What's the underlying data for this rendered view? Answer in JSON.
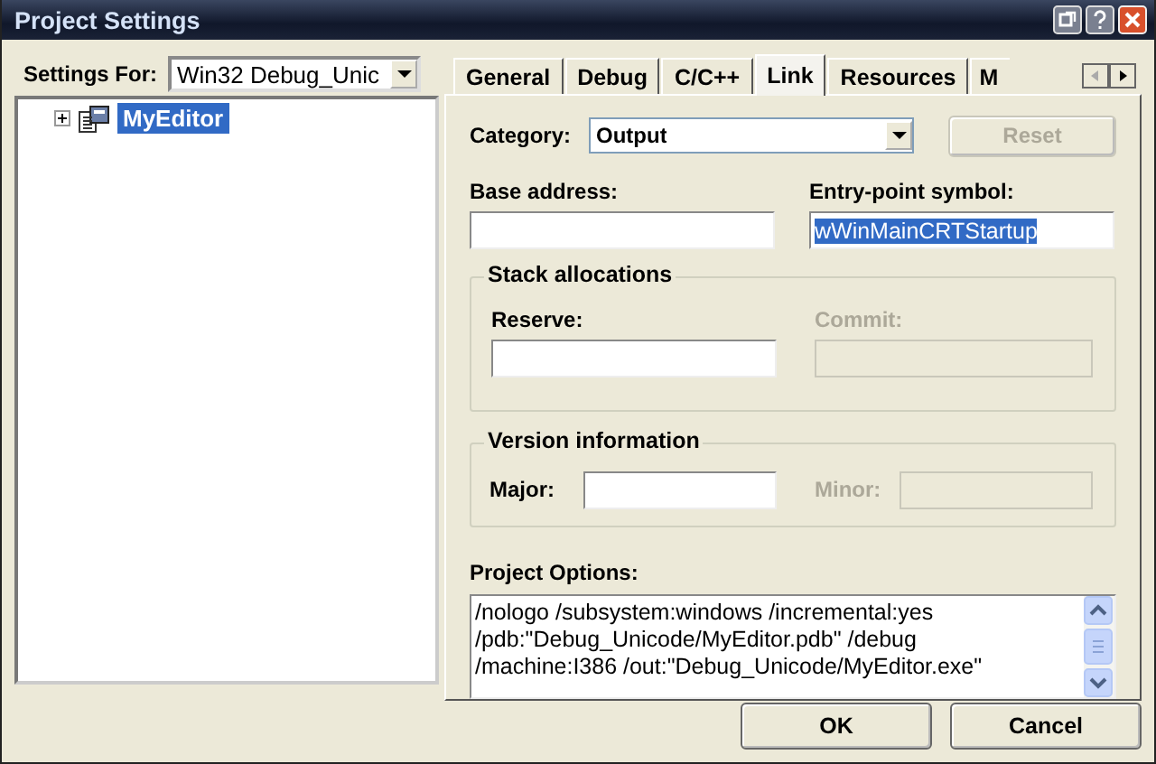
{
  "window": {
    "title": "Project Settings"
  },
  "settings_for": {
    "label": "Settings For:",
    "value": "Win32 Debug_Unic"
  },
  "tree": [
    {
      "label": "MyEditor",
      "expanded": false,
      "selected": true
    }
  ],
  "tabs": [
    {
      "label": "General",
      "selected": false
    },
    {
      "label": "Debug",
      "selected": false
    },
    {
      "label": "C/C++",
      "selected": false
    },
    {
      "label": "Link",
      "selected": true
    },
    {
      "label": "Resources",
      "selected": false
    },
    {
      "label": "M",
      "selected": false
    }
  ],
  "category": {
    "label": "Category:",
    "value": "Output"
  },
  "reset_button": {
    "label": "Reset",
    "disabled": true
  },
  "base_address": {
    "label": "Base address:",
    "disabled": false
  },
  "entry_point": {
    "label": "Entry-point symbol:",
    "value": "wWinMainCRTStartup",
    "value_selected": true,
    "disabled": false
  },
  "stack_allocations": {
    "title": "Stack allocations",
    "reserve": {
      "label": "Reserve:",
      "disabled": false
    },
    "commit": {
      "label": "Commit:",
      "disabled": true
    }
  },
  "version_information": {
    "title": "Version information",
    "major": {
      "label": "Major:",
      "disabled": false
    },
    "minor": {
      "label": "Minor:",
      "disabled": true
    }
  },
  "project_options": {
    "label": "Project Options:",
    "lines": [
      "/nologo /subsystem:windows /incremental:yes",
      "/pdb:\"Debug_Unicode/MyEditor.pdb\" /debug",
      "/machine:I386 /out:\"Debug_Unicode/MyEditor.exe\""
    ]
  },
  "buttons": [
    {
      "label": "OK"
    },
    {
      "label": "Cancel"
    }
  ]
}
